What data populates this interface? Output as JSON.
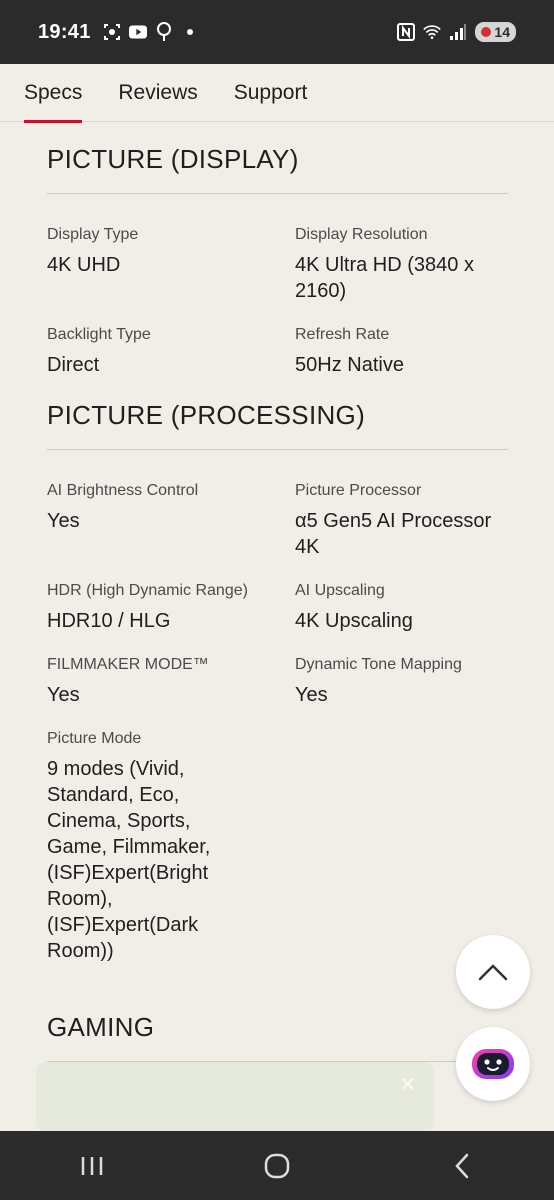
{
  "status_bar": {
    "time": "19:41",
    "battery": "14",
    "icons": [
      "screenshot-icon",
      "youtube-icon",
      "tree-icon",
      "dot-icon",
      "nfc-icon",
      "wifi-icon",
      "signal-icon"
    ]
  },
  "tabs": [
    {
      "label": "Specs",
      "active": true
    },
    {
      "label": "Reviews",
      "active": false
    },
    {
      "label": "Support",
      "active": false
    }
  ],
  "sections": {
    "display": {
      "title": "PICTURE (DISPLAY)",
      "specs": [
        {
          "label": "Display Type",
          "value": "4K UHD"
        },
        {
          "label": "Display Resolution",
          "value": "4K Ultra HD (3840 x 2160)"
        },
        {
          "label": "Backlight Type",
          "value": "Direct"
        },
        {
          "label": "Refresh Rate",
          "value": "50Hz Native"
        }
      ]
    },
    "processing": {
      "title": "PICTURE (PROCESSING)",
      "specs": [
        {
          "label": "AI Brightness Control",
          "value": "Yes"
        },
        {
          "label": "Picture Processor",
          "value": "α5 Gen5 AI Processor 4K"
        },
        {
          "label": "HDR (High Dynamic Range)",
          "value": "HDR10 / HLG"
        },
        {
          "label": "AI Upscaling",
          "value": "4K Upscaling"
        },
        {
          "label": "FILMMAKER MODE™",
          "value": "Yes"
        },
        {
          "label": "Dynamic Tone Mapping",
          "value": "Yes"
        },
        {
          "label": "Picture Mode",
          "value": "9 modes (Vivid, Standard, Eco, Cinema, Sports, Game, Filmmaker, (ISF)Expert(Bright Room), (ISF)Expert(Dark Room))"
        }
      ]
    },
    "gaming": {
      "title": "GAMING"
    }
  },
  "colors": {
    "background": "#f1eee8",
    "accent": "#c8102e",
    "system_bar": "#2b2b2b"
  }
}
